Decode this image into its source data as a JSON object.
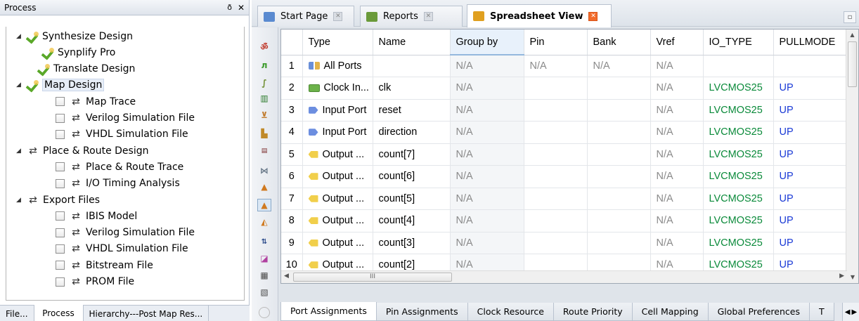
{
  "process_panel": {
    "title": "Process",
    "pin_label": "ð",
    "close_label": "✕",
    "tree": [
      {
        "label": "Synthesize Design",
        "icon": "check-icon",
        "expander": true,
        "checkbox": false,
        "indent": 0
      },
      {
        "label": "Synplify Pro",
        "icon": "check-icon",
        "expander": false,
        "checkbox": false,
        "indent": 1
      },
      {
        "label": "Translate Design",
        "icon": "check-icon",
        "expander": false,
        "checkbox": false,
        "indent": 0
      },
      {
        "label": "Map Design",
        "icon": "check-icon",
        "expander": true,
        "checkbox": false,
        "indent": 0,
        "selected": true
      },
      {
        "label": "Map Trace",
        "icon": "cycle-icon",
        "expander": false,
        "checkbox": true,
        "indent": 1
      },
      {
        "label": "Verilog Simulation File",
        "icon": "cycle-icon",
        "expander": false,
        "checkbox": true,
        "indent": 1
      },
      {
        "label": "VHDL Simulation File",
        "icon": "cycle-icon",
        "expander": false,
        "checkbox": true,
        "indent": 1
      },
      {
        "label": "Place & Route Design",
        "icon": "cycle-icon",
        "expander": true,
        "checkbox": false,
        "indent": 0
      },
      {
        "label": "Place & Route Trace",
        "icon": "cycle-icon",
        "expander": false,
        "checkbox": true,
        "indent": 1
      },
      {
        "label": "I/O Timing Analysis",
        "icon": "cycle-icon",
        "expander": false,
        "checkbox": true,
        "indent": 1
      },
      {
        "label": "Export Files",
        "icon": "cycle-icon",
        "expander": true,
        "checkbox": false,
        "indent": 0
      },
      {
        "label": "IBIS Model",
        "icon": "cycle-icon",
        "expander": false,
        "checkbox": true,
        "indent": 1
      },
      {
        "label": "Verilog Simulation File",
        "icon": "cycle-icon",
        "expander": false,
        "checkbox": true,
        "indent": 1
      },
      {
        "label": "VHDL Simulation File",
        "icon": "cycle-icon",
        "expander": false,
        "checkbox": true,
        "indent": 1
      },
      {
        "label": "Bitstream File",
        "icon": "cycle-icon",
        "expander": false,
        "checkbox": true,
        "indent": 1
      },
      {
        "label": "PROM File",
        "icon": "cycle-icon",
        "expander": false,
        "checkbox": true,
        "indent": 1
      }
    ],
    "bottom_tabs": [
      "File...",
      "Process",
      "Hierarchy---Post Map Res..."
    ],
    "active_bottom_tab": "Process"
  },
  "editor_tabs": [
    {
      "label": "Start Page",
      "icon": "start-page-icon",
      "active": false
    },
    {
      "label": "Reports",
      "icon": "reports-icon",
      "active": false
    },
    {
      "label": "Spreadsheet View",
      "icon": "spreadsheet-icon",
      "active": true
    }
  ],
  "spreadsheet": {
    "columns": [
      "",
      "Type",
      "Name",
      "Group by",
      "Pin",
      "Bank",
      "Vref",
      "IO_TYPE",
      "PULLMODE"
    ],
    "sorted_column": "Group by",
    "rows": [
      {
        "n": "1",
        "type": "All Ports",
        "type_icon": "all-ports-icon",
        "name": "",
        "group": "N/A",
        "pin": "N/A",
        "bank": "N/A",
        "vref": "N/A",
        "io": "",
        "pull": ""
      },
      {
        "n": "2",
        "type": "Clock In...",
        "type_icon": "clock-input-icon",
        "name": "clk",
        "group": "N/A",
        "pin": "",
        "bank": "",
        "vref": "N/A",
        "io": "LVCMOS25",
        "pull": "UP"
      },
      {
        "n": "3",
        "type": "Input Port",
        "type_icon": "input-port-icon",
        "name": "reset",
        "group": "N/A",
        "pin": "",
        "bank": "",
        "vref": "N/A",
        "io": "LVCMOS25",
        "pull": "UP"
      },
      {
        "n": "4",
        "type": "Input Port",
        "type_icon": "input-port-icon",
        "name": "direction",
        "group": "N/A",
        "pin": "",
        "bank": "",
        "vref": "N/A",
        "io": "LVCMOS25",
        "pull": "UP"
      },
      {
        "n": "5",
        "type": "Output ...",
        "type_icon": "output-port-icon",
        "name": "count[7]",
        "group": "N/A",
        "pin": "",
        "bank": "",
        "vref": "N/A",
        "io": "LVCMOS25",
        "pull": "UP"
      },
      {
        "n": "6",
        "type": "Output ...",
        "type_icon": "output-port-icon",
        "name": "count[6]",
        "group": "N/A",
        "pin": "",
        "bank": "",
        "vref": "N/A",
        "io": "LVCMOS25",
        "pull": "UP"
      },
      {
        "n": "7",
        "type": "Output ...",
        "type_icon": "output-port-icon",
        "name": "count[5]",
        "group": "N/A",
        "pin": "",
        "bank": "",
        "vref": "N/A",
        "io": "LVCMOS25",
        "pull": "UP"
      },
      {
        "n": "8",
        "type": "Output ...",
        "type_icon": "output-port-icon",
        "name": "count[4]",
        "group": "N/A",
        "pin": "",
        "bank": "",
        "vref": "N/A",
        "io": "LVCMOS25",
        "pull": "UP"
      },
      {
        "n": "9",
        "type": "Output ...",
        "type_icon": "output-port-icon",
        "name": "count[3]",
        "group": "N/A",
        "pin": "",
        "bank": "",
        "vref": "N/A",
        "io": "LVCMOS25",
        "pull": "UP"
      },
      {
        "n": "10",
        "type": "Output ...",
        "type_icon": "output-port-icon",
        "name": "count[2]",
        "group": "N/A",
        "pin": "",
        "bank": "",
        "vref": "N/A",
        "io": "LVCMOS25",
        "pull": "UP"
      }
    ],
    "hscroll_grip": "III"
  },
  "bottom_tabs": [
    "Port Assignments",
    "Pin Assignments",
    "Clock Resource",
    "Route Priority",
    "Cell Mapping",
    "Global Preferences",
    "T"
  ],
  "active_bottom_tab": "Port Assignments",
  "colors": {
    "io_type": "#0a8a3a",
    "pullmode": "#1a3ad6",
    "na": "#8a8a8a",
    "active_close": "#f26b2a"
  }
}
